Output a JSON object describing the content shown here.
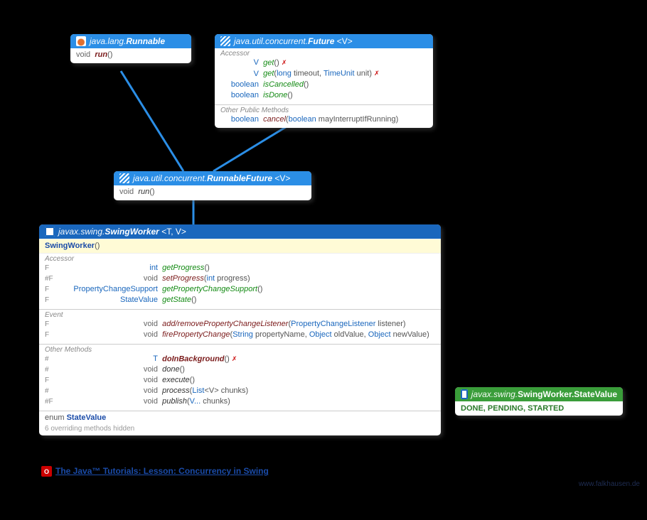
{
  "runnable": {
    "pkg": "java.lang.",
    "name": "Runnable",
    "void": "void",
    "run": "run",
    "parens": "()"
  },
  "future": {
    "pkg": "java.util.concurrent.",
    "name": "Future",
    "tp": "<V>",
    "section_accessor": "Accessor",
    "m1_ret": "V",
    "m1_name": "get",
    "m1_p": "()",
    "m1_exc": "✗",
    "m2_ret": "V",
    "m2_name": "get",
    "m2_p_open": "(",
    "m2_p1t": "long",
    "m2_p1n": " timeout, ",
    "m2_p2t": "TimeUnit",
    "m2_p2n": " unit)",
    "m2_exc": "✗",
    "m3_ret": "boolean",
    "m3_name": "isCancelled",
    "m3_p": "()",
    "m4_ret": "boolean",
    "m4_name": "isDone",
    "m4_p": "()",
    "section_other": "Other Public Methods",
    "m5_ret": "boolean",
    "m5_name": "cancel",
    "m5_p_open": "(",
    "m5_p1t": "boolean",
    "m5_p1n": " mayInterruptIfRunning)"
  },
  "runfuture": {
    "pkg": "java.util.concurrent.",
    "name": "RunnableFuture",
    "tp": "<V>",
    "void": "void",
    "run": "run",
    "parens": "()"
  },
  "swingworker": {
    "pkg": "javax.swing.",
    "name": "SwingWorker",
    "tp": "<T, V>",
    "ctor": "SwingWorker",
    "ctor_p": "()",
    "section_accessor": "Accessor",
    "a1_mod": "F",
    "a1_ret": "int",
    "a1_name": "getProgress",
    "a1_p": "()",
    "a2_mod": "#F",
    "a2_ret": "void",
    "a2_name": "setProgress",
    "a2_p_open": "(",
    "a2_p1t": "int",
    "a2_p1n": " progress)",
    "a3_mod": "F",
    "a3_ret": "PropertyChangeSupport",
    "a3_name": "getPropertyChangeSupport",
    "a3_p": "()",
    "a4_mod": "F",
    "a4_ret": "StateValue",
    "a4_name": "getState",
    "a4_p": "()",
    "section_event": "Event",
    "e1_mod": "F",
    "e1_ret": "void",
    "e1_name": "add/removePropertyChangeListener",
    "e1_p_open": "(",
    "e1_p1t": "PropertyChangeListener",
    "e1_p1n": " listener)",
    "e2_mod": "F",
    "e2_ret": "void",
    "e2_name": "firePropertyChange",
    "e2_p_open": "(",
    "e2_p1t": "String",
    "e2_p1n": " propertyName, ",
    "e2_p2t": "Object",
    "e2_p2n": " oldValue, ",
    "e2_p3t": "Object",
    "e2_p3n": " newValue)",
    "section_other": "Other Methods",
    "o1_mod": "#",
    "o1_ret": "T",
    "o1_name": "doInBackground",
    "o1_p": "()",
    "o1_exc": "✗",
    "o2_mod": "#",
    "o2_ret": "void",
    "o2_name": "done",
    "o2_p": "()",
    "o3_mod": "F",
    "o3_ret": "void",
    "o3_name": "execute",
    "o3_p": "()",
    "o4_mod": "#",
    "o4_ret": "void",
    "o4_name": "process",
    "o4_p_open": "(",
    "o4_p1t": "List",
    "o4_p1tp": "<V>",
    "o4_p1n": " chunks)",
    "o5_mod": "#F",
    "o5_ret": "void",
    "o5_name": "publish",
    "o5_p_open": "(",
    "o5_p1t": "V...",
    "o5_p1n": " chunks)",
    "enum_kw": "enum ",
    "enum_name": "StateValue",
    "hidden": "6 overriding methods hidden"
  },
  "statevalue": {
    "pkg": "javax.swing.",
    "name": "SwingWorker.StateValue",
    "values": "DONE, PENDING, STARTED"
  },
  "footer": {
    "link": "The Java™ Tutorials: Lesson: Concurrency in Swing"
  },
  "watermark": "www.falkhausen.de"
}
